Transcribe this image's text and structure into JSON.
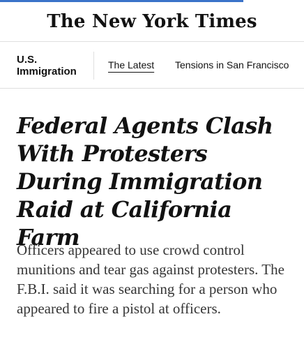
{
  "header": {
    "logo_text": "The New York Times",
    "progress": 0.8
  },
  "section_nav": {
    "section_title": "U.S. Immigration",
    "links": [
      {
        "label": "The Latest",
        "active": true
      },
      {
        "label": "Tensions in San Francisco",
        "active": false
      }
    ]
  },
  "article": {
    "headline": "Federal Agents Clash With Protesters During Immigration Raid at California Farm",
    "summary": "Officers appeared to use crowd control munitions and tear gas against protesters. The F.B.I. said it was searching for a person who appeared to fire a pistol at officers."
  },
  "colors": {
    "progress": "#3b73c9",
    "text": "#121212",
    "summary_text": "#363636",
    "divider": "#dfdfdf"
  }
}
